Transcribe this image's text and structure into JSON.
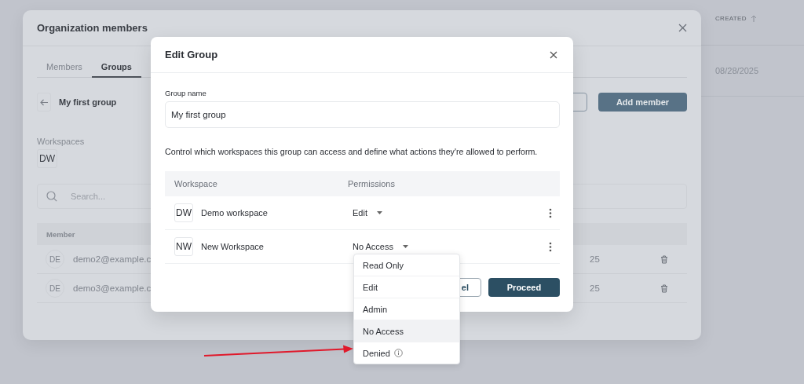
{
  "page": {
    "created_header": "CREATED",
    "created_date": "08/28/2025"
  },
  "org_modal": {
    "title": "Organization members",
    "tabs": [
      {
        "label": "Members",
        "selected": false
      },
      {
        "label": "Groups",
        "selected": true
      }
    ],
    "group_title": "My first group",
    "add_member": "Add member",
    "workspaces_label": "Workspaces",
    "workspace_chips": [
      "DW"
    ],
    "search": {
      "placeholder": "Search..."
    },
    "member_column": "Member",
    "members": [
      {
        "initials": "DE",
        "email": "demo2@example.c",
        "date": "25"
      },
      {
        "initials": "DE",
        "email": "demo3@example.c",
        "date": "25"
      }
    ]
  },
  "edit_modal": {
    "title": "Edit Group",
    "group_name_label": "Group name",
    "group_name": "My first group",
    "description": "Control which workspaces this group can access and define what actions they're allowed to perform.",
    "columns": [
      "Workspace",
      "Permissions"
    ],
    "rows": [
      {
        "initials": "DW",
        "name": "Demo workspace",
        "permission": "Edit"
      },
      {
        "initials": "NW",
        "name": "New Workspace",
        "permission": "No Access"
      }
    ],
    "cancel": "el",
    "proceed": "Proceed"
  },
  "dropdown": {
    "options": [
      {
        "label": "Read Only",
        "selected": false,
        "info": false
      },
      {
        "label": "Edit",
        "selected": false,
        "info": false
      },
      {
        "label": "Admin",
        "selected": false,
        "info": false
      },
      {
        "label": "No Access",
        "selected": true,
        "info": false
      },
      {
        "label": "Denied",
        "selected": false,
        "info": true
      }
    ]
  }
}
